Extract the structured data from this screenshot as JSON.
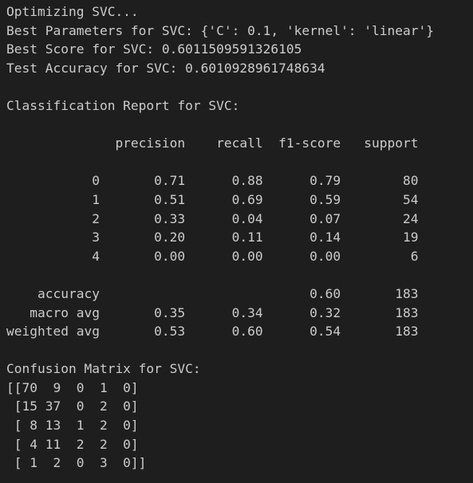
{
  "terminal": {
    "lines": [
      "Optimizing SVC...",
      "Best Parameters for SVC: {'C': 0.1, 'kernel': 'linear'}",
      "Best Score for SVC: 0.6011509591326105",
      "Test Accuracy for SVC: 0.6010928961748634",
      "",
      "Classification Report for SVC:",
      "",
      "              precision    recall  f1-score   support",
      "",
      "           0       0.71      0.88      0.79        80",
      "           1       0.51      0.69      0.59        54",
      "           2       0.33      0.04      0.07        24",
      "           3       0.20      0.11      0.14        19",
      "           4       0.00      0.00      0.00         6",
      "",
      "    accuracy                           0.60       183",
      "   macro avg       0.35      0.34      0.32       183",
      "weighted avg       0.53      0.60      0.54       183",
      "",
      "Confusion Matrix for SVC:",
      "[[70  9  0  1  0]",
      " [15 37  0  2  0]",
      " [ 8 13  1  2  0]",
      " [ 4 11  2  2  0]",
      " [ 1  2  0  3  0]]"
    ]
  }
}
